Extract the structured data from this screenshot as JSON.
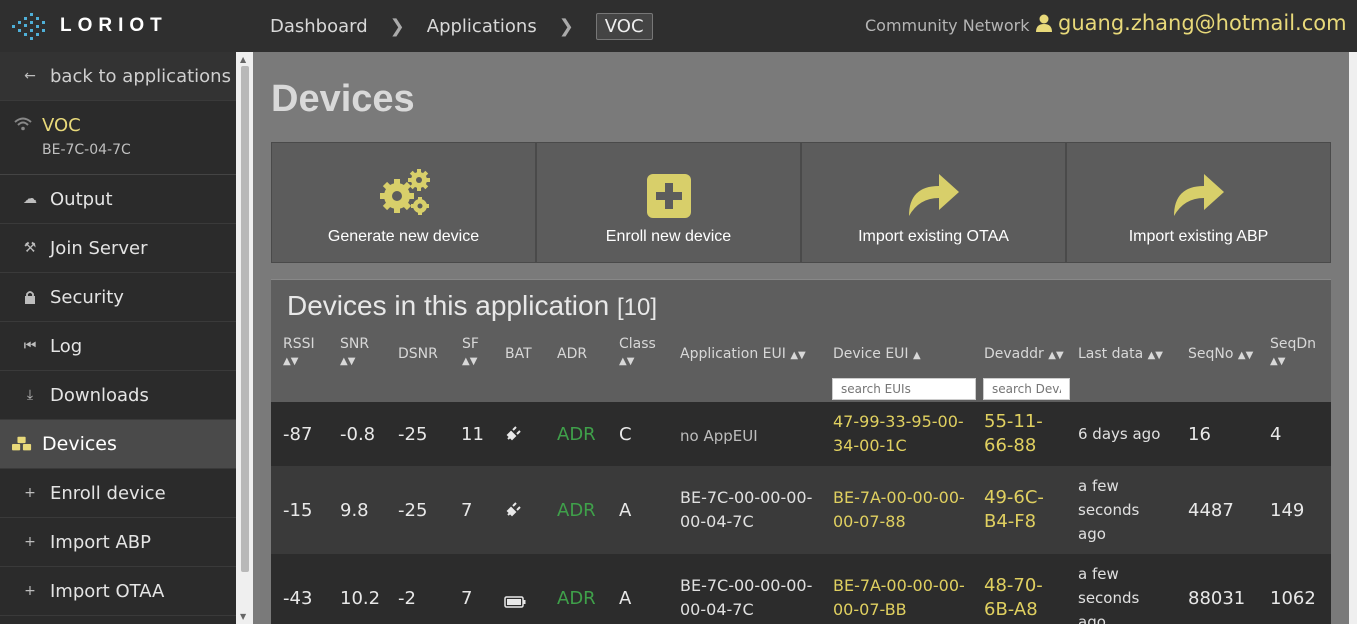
{
  "brand": {
    "name": "LORIOT"
  },
  "breadcrumb": {
    "dashboard": "Dashboard",
    "applications": "Applications",
    "current": "VOC"
  },
  "header": {
    "network": "Community Network",
    "user": "guang.zhang@hotmail.com"
  },
  "sidebar": {
    "back": "back to applications",
    "app_name": "VOC",
    "app_id": "BE-7C-04-7C",
    "items": [
      {
        "label": "Output"
      },
      {
        "label": "Join Server"
      },
      {
        "label": "Security"
      },
      {
        "label": "Log"
      },
      {
        "label": "Downloads"
      },
      {
        "label": "Devices"
      },
      {
        "label": "Enroll device"
      },
      {
        "label": "Import ABP"
      },
      {
        "label": "Import OTAA"
      }
    ]
  },
  "page": {
    "title": "Devices"
  },
  "actions": {
    "generate": "Generate new device",
    "enroll": "Enroll new device",
    "import_otaa": "Import existing OTAA",
    "import_abp": "Import existing ABP"
  },
  "table": {
    "title": "Devices in this application",
    "count": "[10]",
    "headers": {
      "rssi": "RSSI",
      "snr": "SNR",
      "dsnr": "DSNR",
      "sf": "SF",
      "bat": "BAT",
      "adr": "ADR",
      "class": "Class",
      "appeui": "Application EUI",
      "deveui": "Device EUI",
      "devaddr": "Devaddr",
      "lastdata": "Last data",
      "seqno": "SeqNo",
      "seqdn": "SeqDn"
    },
    "search_eui_placeholder": "search EUIs",
    "search_devaddr_placeholder": "search DevAddr",
    "rows": [
      {
        "rssi": "-87",
        "snr": "-0.8",
        "dsnr": "-25",
        "sf": "11",
        "bat": "plug",
        "adr": "ADR",
        "class": "C",
        "appeui": "no AppEUI",
        "deveui_1": "47-99-33-95-00-",
        "deveui_2": "34-00-1C",
        "devaddr_1": "55-11-",
        "devaddr_2": "66-88",
        "last_1": "6 days ago",
        "last_2": "",
        "last_3": "",
        "seqno": "16",
        "seqdn": "4"
      },
      {
        "rssi": "-15",
        "snr": "9.8",
        "dsnr": "-25",
        "sf": "7",
        "bat": "plug",
        "adr": "ADR",
        "class": "A",
        "appeui_1": "BE-7C-00-00-00-",
        "appeui_2": "00-04-7C",
        "deveui_1": "BE-7A-00-00-00-",
        "deveui_2": "00-07-88",
        "devaddr_1": "49-6C-",
        "devaddr_2": "B4-F8",
        "last_1": "a few",
        "last_2": "seconds",
        "last_3": "ago",
        "seqno": "4487",
        "seqdn": "149"
      },
      {
        "rssi": "-43",
        "snr": "10.2",
        "dsnr": "-2",
        "sf": "7",
        "bat": "battery",
        "adr": "ADR",
        "class": "A",
        "appeui_1": "BE-7C-00-00-00-",
        "appeui_2": "00-04-7C",
        "deveui_1": "BE-7A-00-00-00-",
        "deveui_2": "00-07-BB",
        "devaddr_1": "48-70-",
        "devaddr_2": "6B-A8",
        "last_1": "a few",
        "last_2": "seconds",
        "last_3": "ago",
        "seqno": "88031",
        "seqdn": "1062"
      }
    ]
  },
  "colors": {
    "accent": "#e8d97a",
    "adr_green": "#3fa04a",
    "topbar": "#2f2f2f",
    "sidebar": "#2b2b2b"
  }
}
